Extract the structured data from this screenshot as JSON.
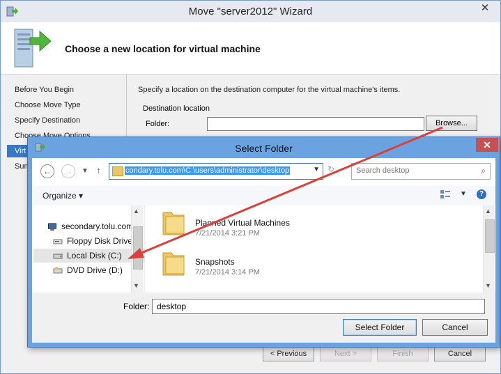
{
  "wizard": {
    "title": "Move \"server2012\" Wizard",
    "close_glyph": "✕",
    "header_title": "Choose a new location for virtual machine",
    "nav_items": [
      "Before You Begin",
      "Choose Move Type",
      "Specify Destination",
      "Choose Move Options",
      "Virtual Machine",
      "Summary"
    ],
    "nav_visible": [
      "Before You Begin",
      "Choose Move Type",
      "Specify Destination",
      "Choose Move Options",
      "Virt",
      "Sum"
    ],
    "description": "Specify a location on the destination computer for the virtual machine's items.",
    "destination_group_label": "Destination location",
    "folder_label": "Folder:",
    "folder_value": "",
    "browse_label": "Browse...",
    "buttons": {
      "previous": "< Previous",
      "next": "Next >",
      "finish": "Finish",
      "cancel": "Cancel"
    }
  },
  "dialog": {
    "title": "Select Folder",
    "close_glyph": "✕",
    "address": "condary.tolu.com\\C:\\users\\administrator\\desktop",
    "search_placeholder": "Search desktop",
    "organize_label": "Organize",
    "tree": [
      {
        "label": "secondary.tolu.com",
        "icon": "computer-icon"
      },
      {
        "label": "Floppy Disk Drive",
        "icon": "floppy-drive-icon"
      },
      {
        "label": "Local Disk (C:)",
        "icon": "hard-disk-icon",
        "selected": true
      },
      {
        "label": "DVD Drive (D:)",
        "icon": "dvd-drive-icon"
      }
    ],
    "files": [
      {
        "name": "Planned Virtual Machines",
        "date": "7/21/2014 3:21 PM",
        "icon": "folder-icon"
      },
      {
        "name": "Snapshots",
        "date": "7/21/2014 3:14 PM",
        "icon": "folder-icon"
      }
    ],
    "folder_label": "Folder:",
    "folder_value": "desktop",
    "select_label": "Select Folder",
    "cancel_label": "Cancel"
  },
  "colors": {
    "dialog_frame": "#6aa3e0",
    "selection": "#3399ff",
    "annotation_arrow": "#d9413a"
  }
}
